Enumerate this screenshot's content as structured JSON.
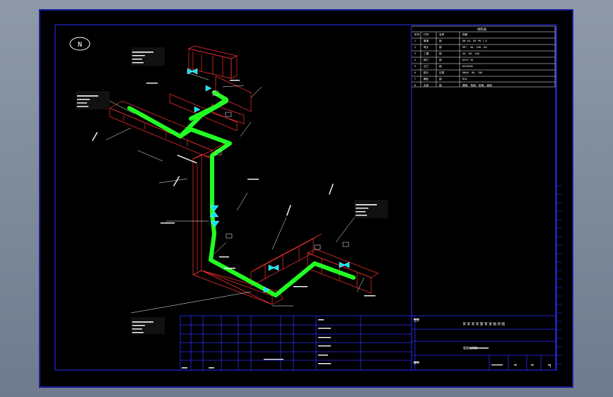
{
  "drawing": {
    "north_symbol": "N",
    "title_text": "某某某装置管道轴测图",
    "colors": {
      "background": "#000000",
      "frame": "#2a2dff",
      "pipe_main": "#22ff22",
      "support": "#ff3030",
      "valve": "#00e5ff",
      "text": "#ffffff",
      "outer": "#7e8a9b"
    }
  },
  "table": {
    "title": "材料表",
    "headers": [
      "序号",
      "代号",
      "名称",
      "规格"
    ],
    "rows": [
      [
        "1",
        "管道",
        "钢",
        "DN 40, 80 PN 1.6"
      ],
      [
        "2",
        "弯头",
        "钢",
        "90°, 40, 100, 80"
      ],
      [
        "3",
        "三通",
        "钢",
        "40, 80, 100"
      ],
      [
        "4",
        "阀门",
        "钢",
        "Q41F-16"
      ],
      [
        "5",
        "法兰",
        "钢",
        "HG20592"
      ],
      [
        "6",
        "垫片",
        "石棉",
        "DN40, 80, 100"
      ],
      [
        "7",
        "螺栓",
        "钢",
        "M16"
      ],
      [
        "8",
        "支架",
        "钢",
        "槽钢, 角钢, 型钢, 扁钢"
      ]
    ]
  },
  "title_block": {
    "right_labels": [
      "设计",
      "管道轴测图",
      "图号"
    ],
    "sheet_value": "1"
  }
}
